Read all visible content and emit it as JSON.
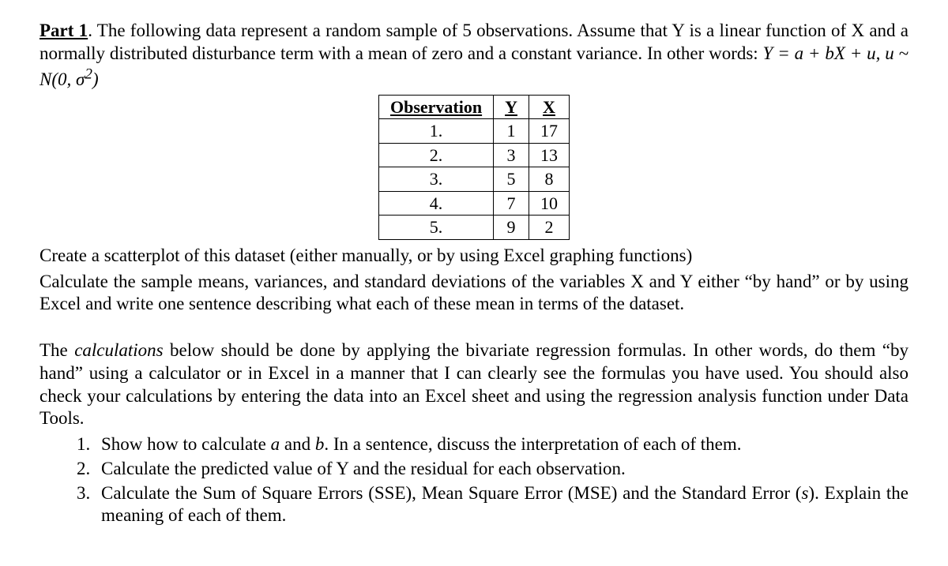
{
  "part_label": "Part 1",
  "intro_text_1": ". The following data represent a random sample of 5 observations. Assume that Y is a linear function of X and a normally distributed disturbance term with a mean of zero and a constant variance. In other words: ",
  "equation_plain": "Y = a + bX + u, u ~ N(0, σ²)",
  "table": {
    "headers": [
      "Observation",
      "Y",
      "X"
    ],
    "rows": [
      [
        "1.",
        "1",
        "17"
      ],
      [
        "2.",
        "3",
        "13"
      ],
      [
        "3.",
        "5",
        "8"
      ],
      [
        "4.",
        "7",
        "10"
      ],
      [
        "5.",
        "9",
        "2"
      ]
    ]
  },
  "instruction_1": "Create a scatterplot of this dataset (either manually, or by using Excel graphing functions)",
  "instruction_2": "Calculate the sample means, variances, and standard deviations of the variables X and Y either “by hand” or by using Excel and write one sentence describing what each of these mean in terms of the dataset.",
  "second_para_pre": "The ",
  "second_para_italic": "calculations",
  "second_para_post": " below should be done by applying the bivariate regression formulas. In other words, do them “by hand” using a calculator or in Excel in a manner that I can clearly see the formulas you have used. You should also check your calculations by entering the data into an Excel sheet and using the regression analysis function under Data Tools.",
  "list": {
    "item1_pre": "Show how to calculate ",
    "item1_a": "a",
    "item1_mid": " and ",
    "item1_b": "b",
    "item1_post": ". In a sentence, discuss the interpretation of each of them.",
    "item2": "Calculate the predicted value of Y and the residual for each observation.",
    "item3_pre": "Calculate the Sum of Square Errors (SSE), Mean Square Error (MSE) and the Standard Error (",
    "item3_s": "s",
    "item3_post": "). Explain the meaning of each of them."
  }
}
